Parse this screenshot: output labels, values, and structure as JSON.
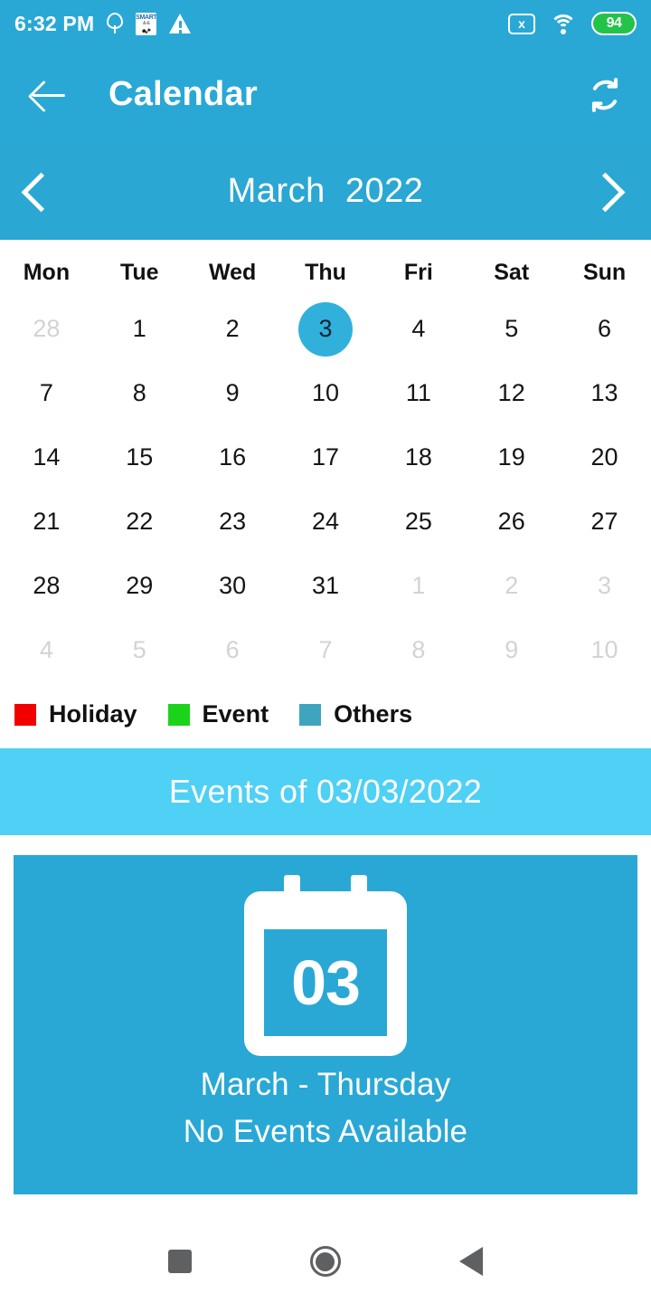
{
  "status_bar": {
    "time": "6:32 PM",
    "left_icons": [
      "location-icon",
      "smart-app-icon",
      "warning-icon"
    ],
    "right_icons": [
      "no-sim-icon",
      "wifi-icon",
      "battery-icon"
    ],
    "no_sim_glyph": "x",
    "battery_level": "94",
    "battery_color": "#23c34a",
    "background": "#29a8d5"
  },
  "app_bar": {
    "back_label": "back-arrow",
    "title": "Calendar",
    "refresh_label": "refresh-icon",
    "background": "#29a8d5"
  },
  "month_bar": {
    "prev_label": "previous-month",
    "label": "March  2022",
    "month": "March",
    "year": "2022",
    "next_label": "next-month",
    "background": "#2aa7d3"
  },
  "calendar": {
    "weekdays": [
      "Mon",
      "Tue",
      "Wed",
      "Thu",
      "Fri",
      "Sat",
      "Sun"
    ],
    "selected_day": "3",
    "selected_color": "#31b0db",
    "weeks": [
      [
        {
          "label": "28",
          "muted": true
        },
        {
          "label": "1",
          "muted": false
        },
        {
          "label": "2",
          "muted": false
        },
        {
          "label": "3",
          "muted": false,
          "selected": true
        },
        {
          "label": "4",
          "muted": false
        },
        {
          "label": "5",
          "muted": false
        },
        {
          "label": "6",
          "muted": false
        }
      ],
      [
        {
          "label": "7",
          "muted": false
        },
        {
          "label": "8",
          "muted": false
        },
        {
          "label": "9",
          "muted": false
        },
        {
          "label": "10",
          "muted": false
        },
        {
          "label": "11",
          "muted": false
        },
        {
          "label": "12",
          "muted": false
        },
        {
          "label": "13",
          "muted": false
        }
      ],
      [
        {
          "label": "14",
          "muted": false
        },
        {
          "label": "15",
          "muted": false
        },
        {
          "label": "16",
          "muted": false
        },
        {
          "label": "17",
          "muted": false
        },
        {
          "label": "18",
          "muted": false
        },
        {
          "label": "19",
          "muted": false
        },
        {
          "label": "20",
          "muted": false
        }
      ],
      [
        {
          "label": "21",
          "muted": false
        },
        {
          "label": "22",
          "muted": false
        },
        {
          "label": "23",
          "muted": false
        },
        {
          "label": "24",
          "muted": false
        },
        {
          "label": "25",
          "muted": false
        },
        {
          "label": "26",
          "muted": false
        },
        {
          "label": "27",
          "muted": false
        }
      ],
      [
        {
          "label": "28",
          "muted": false
        },
        {
          "label": "29",
          "muted": false
        },
        {
          "label": "30",
          "muted": false
        },
        {
          "label": "31",
          "muted": false
        },
        {
          "label": "1",
          "muted": true
        },
        {
          "label": "2",
          "muted": true
        },
        {
          "label": "3",
          "muted": true
        }
      ],
      [
        {
          "label": "4",
          "muted": true
        },
        {
          "label": "5",
          "muted": true
        },
        {
          "label": "6",
          "muted": true
        },
        {
          "label": "7",
          "muted": true
        },
        {
          "label": "8",
          "muted": true
        },
        {
          "label": "9",
          "muted": true
        },
        {
          "label": "10",
          "muted": true
        }
      ]
    ]
  },
  "legend": [
    {
      "label": "Holiday",
      "color": "#f20000"
    },
    {
      "label": "Event",
      "color": "#1ad419"
    },
    {
      "label": "Others",
      "color": "#3fa5bf"
    }
  ],
  "events_header": {
    "text": "Events of 03/03/2022",
    "background": "#4fd0f5"
  },
  "event_card": {
    "day_number": "03",
    "line1": "March - Thursday",
    "line2": "No Events Available",
    "background": "#29a8d5"
  },
  "nav_bar": {
    "recents_label": "recents-button",
    "home_label": "home-button",
    "back_label": "back-button"
  }
}
